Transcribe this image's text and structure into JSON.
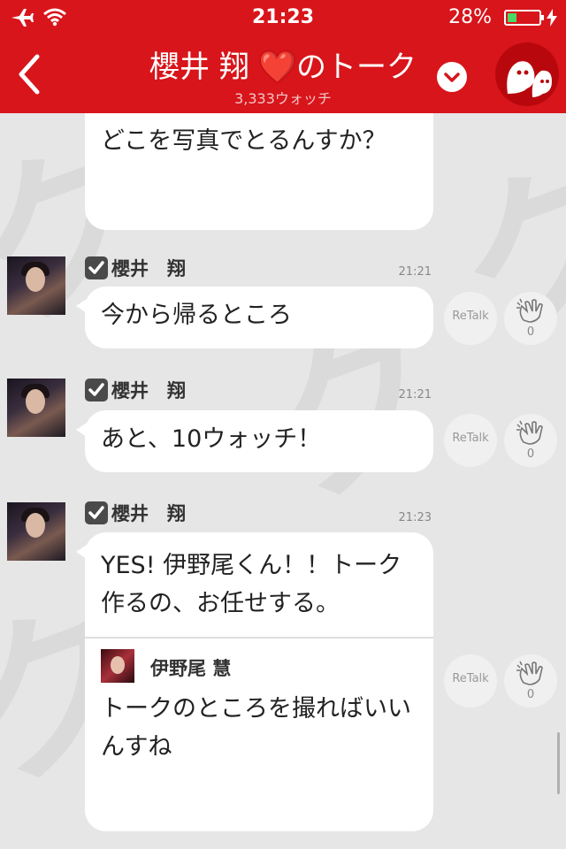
{
  "status_bar": {
    "time": "21:23",
    "battery_percent": "28%",
    "battery_level": 0.28
  },
  "header": {
    "title_name": "櫻井 翔",
    "title_heart": "❤️",
    "title_suffix": "のトーク",
    "watch_count": "3,333ウォッチ"
  },
  "messages": [
    {
      "partial": true,
      "text": "どこを写真でとるんすか？"
    },
    {
      "name": "櫻井　翔",
      "time": "21:21",
      "text": "今から帰るところ",
      "retalk": "ReTalk",
      "clap_count": "0"
    },
    {
      "name": "櫻井　翔",
      "time": "21:21",
      "text": "あと、10ウォッチ！",
      "retalk": "ReTalk",
      "clap_count": "0"
    },
    {
      "name": "櫻井　翔",
      "time": "21:23",
      "text": "YES! 伊野尾くん！！トーク作るの、お任せする。",
      "quote": {
        "name": "伊野尾 慧",
        "text": "トークのところを撮ればいいんすね"
      },
      "retalk": "ReTalk",
      "clap_count": "0"
    }
  ]
}
